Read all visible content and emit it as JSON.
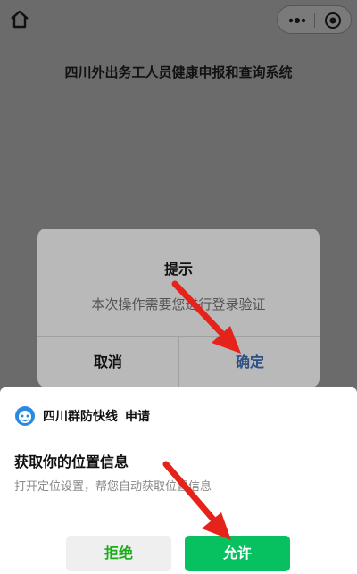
{
  "page": {
    "title": "四川外出务工人员健康申报和查询系统"
  },
  "alert": {
    "title": "提示",
    "message": "本次操作需要您进行登录验证",
    "cancel_label": "取消",
    "confirm_label": "确定"
  },
  "sheet": {
    "app_name": "四川群防快线",
    "action": "申请",
    "permission_title": "获取你的位置信息",
    "permission_desc": "打开定位设置，帮您自动获取位置信息",
    "deny_label": "拒绝",
    "allow_label": "允许"
  },
  "icons": {
    "home": "home-icon",
    "more": "more-icon",
    "close": "close-icon",
    "app": "app-logo-icon"
  },
  "colors": {
    "allow_bg": "#07c160",
    "deny_text": "#1aad19",
    "confirm_text": "#2b4f86",
    "arrow": "#e5231b"
  }
}
